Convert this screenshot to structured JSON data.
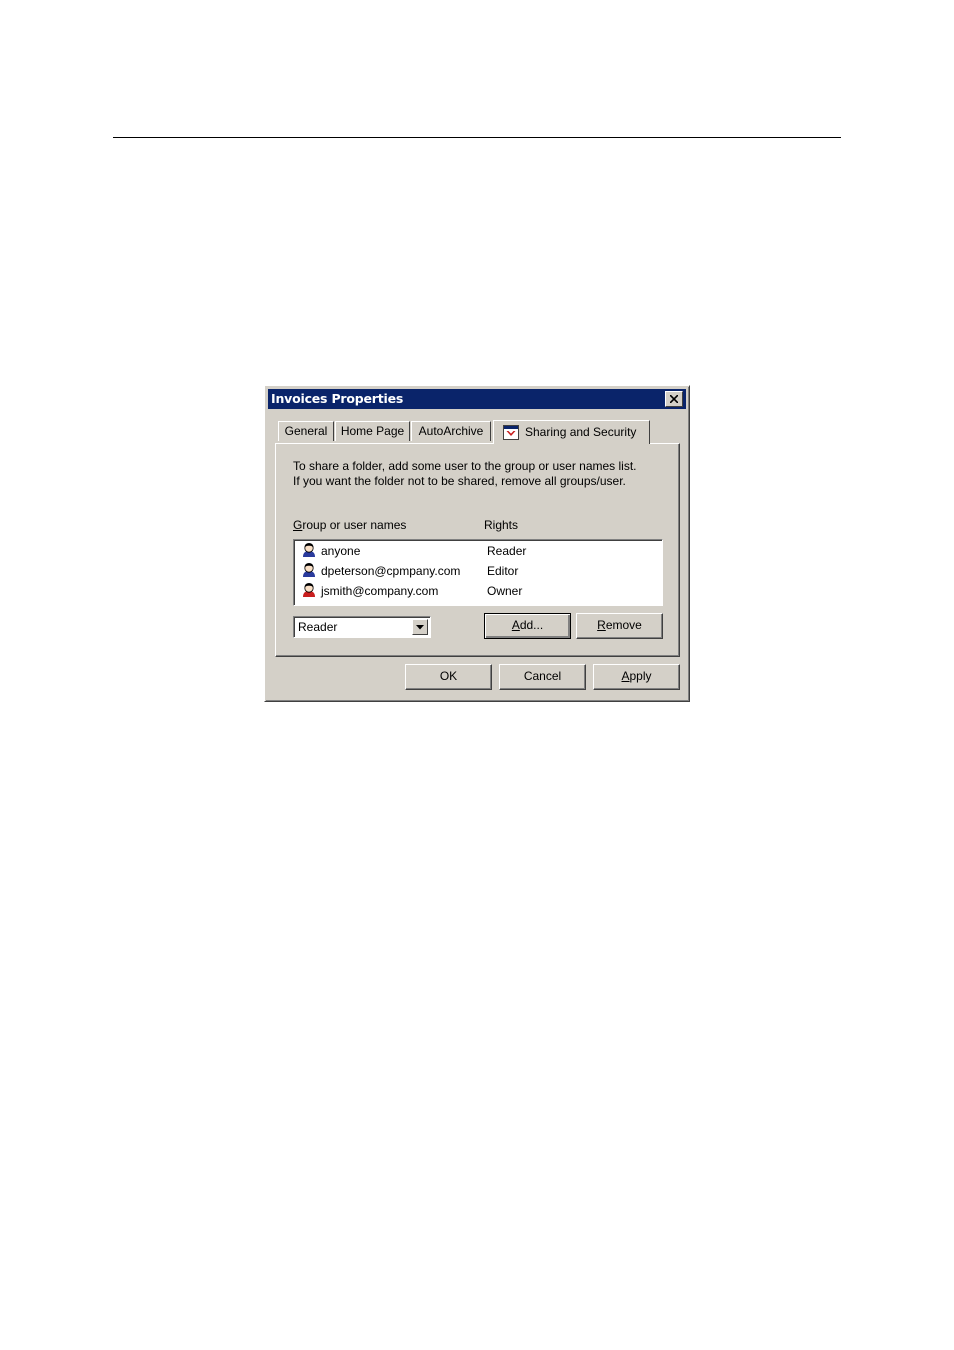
{
  "dialog": {
    "title": "Invoices Properties",
    "close_icon": "close-icon"
  },
  "tabs": [
    {
      "label": "General",
      "active": false
    },
    {
      "label": "Home Page",
      "active": false
    },
    {
      "label": "AutoArchive",
      "active": false
    },
    {
      "label": "Sharing and Security",
      "active": true,
      "icon": "sharing-icon"
    }
  ],
  "sharing": {
    "description_line1": "To share a folder, add some user to the group or user names list.",
    "description_line2": "If you want the folder not to be shared, remove all groups/user.",
    "column_names": "Group or user names",
    "column_rights": "Rights",
    "users": [
      {
        "name": "anyone",
        "rights": "Reader",
        "icon": "user-icon",
        "icon_accent": "#2a3a9c"
      },
      {
        "name": "dpeterson@cpmpany.com",
        "rights": "Editor",
        "icon": "user-icon",
        "icon_accent": "#2a3a9c"
      },
      {
        "name": "jsmith@company.com",
        "rights": "Owner",
        "icon": "user-icon",
        "icon_accent": "#c81e1e"
      }
    ],
    "rights_select": {
      "value": "Reader"
    },
    "add_label": "Add...",
    "remove_label": "Remove"
  },
  "footer": {
    "ok_label": "OK",
    "cancel_label": "Cancel",
    "apply_label": "Apply"
  },
  "colors": {
    "titlebar": "#0a246a",
    "dialog_face": "#d4d0c8"
  }
}
